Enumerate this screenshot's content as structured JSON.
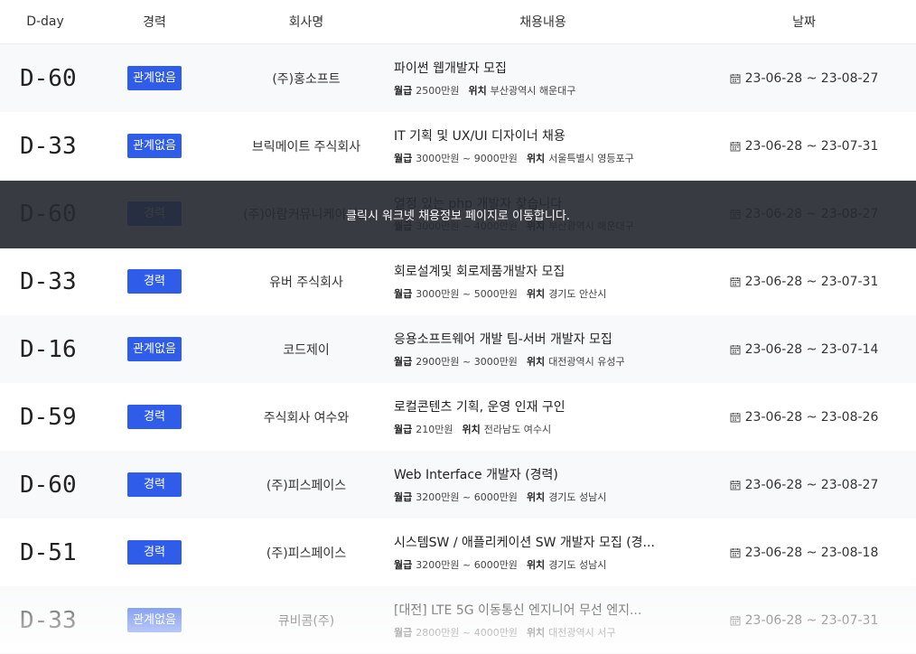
{
  "header": {
    "dday": "D-day",
    "career": "경력",
    "company": "회사명",
    "content": "채용내용",
    "date": "날짜"
  },
  "labels": {
    "salary": "월급",
    "location": "위치"
  },
  "overlay_text": "클릭시 워크넷 채용정보 페이지로 이동합니다.",
  "rows": [
    {
      "dday": "D-60",
      "career": "관계없음",
      "company": "(주)홍소프트",
      "title": "파이썬 웹개발자 모집",
      "salary": "2500만원",
      "location": "부산광역시 해운대구",
      "date": "23-06-28 ~ 23-08-27"
    },
    {
      "dday": "D-33",
      "career": "관계없음",
      "company": "브릭메이트 주식회사",
      "title": "IT 기획 및 UX/UI 디자이너 채용",
      "salary": "3000만원 ~ 9000만원",
      "location": "서울특별시 영등포구",
      "date": "23-06-28 ~ 23-07-31"
    },
    {
      "dday": "D-60",
      "career": "경력",
      "company": "(주)아람커뮤니케이션즈",
      "title": "열정 있는 php 개발자 찾습니다",
      "salary": "3000만원 ~ 4000만원",
      "location": "부산광역시 해운대구",
      "date": "23-06-28 ~ 23-08-27"
    },
    {
      "dday": "D-33",
      "career": "경력",
      "company": "유버 주식회사",
      "title": "회로설계및 회로제품개발자 모집",
      "salary": "3000만원 ~ 5000만원",
      "location": "경기도 안산시",
      "date": "23-06-28 ~ 23-07-31"
    },
    {
      "dday": "D-16",
      "career": "관계없음",
      "company": "코드제이",
      "title": "응용소프트웨어 개발 팀-서버 개발자 모집",
      "salary": "2900만원 ~ 3000만원",
      "location": "대전광역시 유성구",
      "date": "23-06-28 ~ 23-07-14"
    },
    {
      "dday": "D-59",
      "career": "경력",
      "company": "주식회사 여수와",
      "title": "로컬콘텐츠 기획, 운영 인재 구인",
      "salary": "210만원",
      "location": "전라남도 여수시",
      "date": "23-06-28 ~ 23-08-26"
    },
    {
      "dday": "D-60",
      "career": "경력",
      "company": "(주)피스페이스",
      "title": "Web Interface 개발자 (경력)",
      "salary": "3200만원 ~ 6000만원",
      "location": "경기도 성남시",
      "date": "23-06-28 ~ 23-08-27"
    },
    {
      "dday": "D-51",
      "career": "경력",
      "company": "(주)피스페이스",
      "title": "시스템SW / 애플리케이션 SW 개발자 모집 (경...",
      "salary": "3200만원 ~ 6000만원",
      "location": "경기도 성남시",
      "date": "23-06-28 ~ 23-08-18"
    },
    {
      "dday": "D-33",
      "career": "관계없음",
      "company": "큐비콤(주)",
      "title": "[대전] LTE 5G 이동통신 엔지니어 무선 엔지...",
      "salary": "2800만원 ~ 4000만원",
      "location": "대전광역시 서구",
      "date": "23-06-28 ~ 23-07-31"
    }
  ],
  "colors": {
    "badge": "#2f5dea",
    "overlay": "#282a32"
  }
}
